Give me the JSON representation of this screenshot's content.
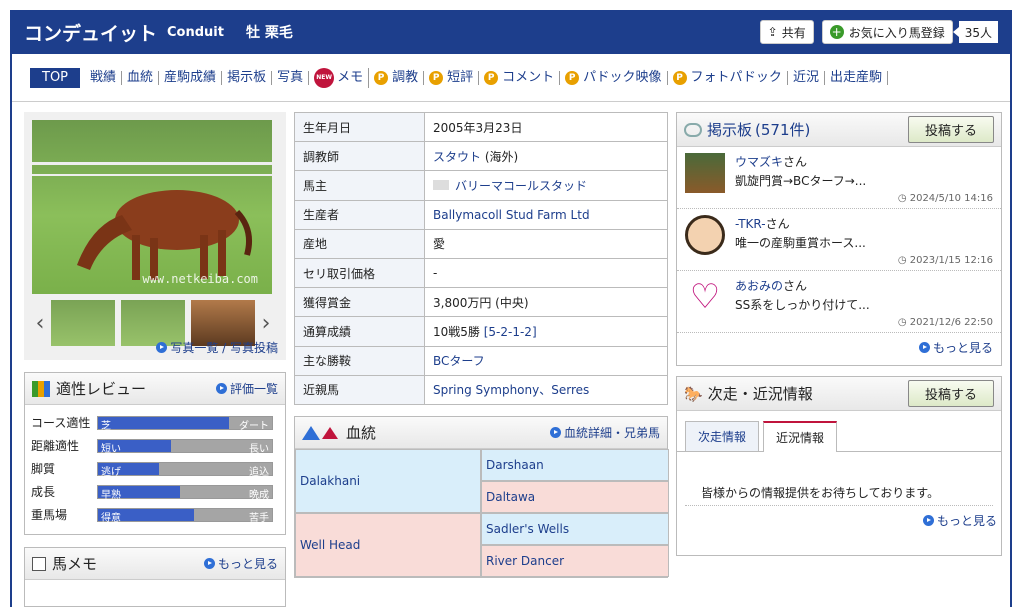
{
  "header": {
    "name": "コンデュイット",
    "name_en": "Conduit",
    "sex_color": "牡 栗毛",
    "share_label": "共有",
    "fav_label": "お気に入り馬登録",
    "fav_count": "35人"
  },
  "nav": {
    "items": [
      "TOP",
      "戦績",
      "血統",
      "産駒成績",
      "掲示板",
      "写真",
      "メモ",
      "調教",
      "短評",
      "コメント",
      "パドック映像",
      "フォトパドック",
      "近況",
      "出走産駒"
    ],
    "new_badge": "NEW",
    "p_badge": "P"
  },
  "photo": {
    "watermark": "www.netkeiba.com",
    "link": "写真一覧 / 写真投稿"
  },
  "review": {
    "title": "適性レビュー",
    "more": "評価一覧",
    "rows": [
      {
        "label": "コース適性",
        "left": "芝",
        "right": "ダート",
        "level": 0.75
      },
      {
        "label": "距離適性",
        "left": "短い",
        "right": "長い",
        "level": 0.42
      },
      {
        "label": "脚質",
        "left": "逃げ",
        "right": "追込",
        "level": 0.35
      },
      {
        "label": "成長",
        "left": "早熟",
        "right": "晩成",
        "level": 0.47
      },
      {
        "label": "重馬場",
        "left": "得意",
        "right": "苦手",
        "level": 0.55
      }
    ]
  },
  "memo": {
    "title": "馬メモ",
    "more": "もっと見る"
  },
  "profile": [
    {
      "k": "生年月日",
      "v": "2005年3月23日"
    },
    {
      "k": "調教師",
      "v": "スタウト",
      "v2": "(海外)"
    },
    {
      "k": "馬主",
      "v": "バリーマコールスタッド"
    },
    {
      "k": "生産者",
      "v": "Ballymacoll Stud Farm Ltd"
    },
    {
      "k": "産地",
      "v": "愛"
    },
    {
      "k": "セリ取引価格",
      "v": "-"
    },
    {
      "k": "獲得賞金",
      "v": "3,800万円 (中央)"
    },
    {
      "k": "通算成績",
      "v": "10戦5勝",
      "v2": "[5-2-1-2]"
    },
    {
      "k": "主な勝鞍",
      "v": "BCターフ"
    },
    {
      "k": "近親馬",
      "v": "Spring Symphony、Serres"
    }
  ],
  "blood": {
    "title": "血統",
    "more": "血統詳細・兄弟馬",
    "sire": "Dalakhani",
    "sire_sire": "Darshaan",
    "sire_dam": "Daltawa",
    "dam": "Well Head",
    "dam_sire": "Sadler's Wells",
    "dam_dam": "River Dancer"
  },
  "board": {
    "title": "掲示板",
    "count": "(571件)",
    "post": "投稿する",
    "more": "もっと見る",
    "items": [
      {
        "user": "ウマズキ",
        "san": "さん",
        "text": "凱旋門賞→BCターフ→...",
        "time": "2024/5/10 14:16"
      },
      {
        "user": "-TKR-",
        "san": "さん",
        "text": "唯一の産駒重賞ホース...",
        "time": "2023/1/15 12:16"
      },
      {
        "user": "あおみの",
        "san": "さん",
        "text": "SS系をしっかり付けて...",
        "time": "2021/12/6 22:50"
      }
    ]
  },
  "next": {
    "title": "次走・近況情報",
    "post": "投稿する",
    "tab1": "次走情報",
    "tab2": "近況情報",
    "message": "皆様からの情報提供をお待ちしております。",
    "more": "もっと見る"
  },
  "colors": {
    "brand": "#1d3e8c",
    "accent": "#c0143c",
    "badge": "#e8a000"
  }
}
